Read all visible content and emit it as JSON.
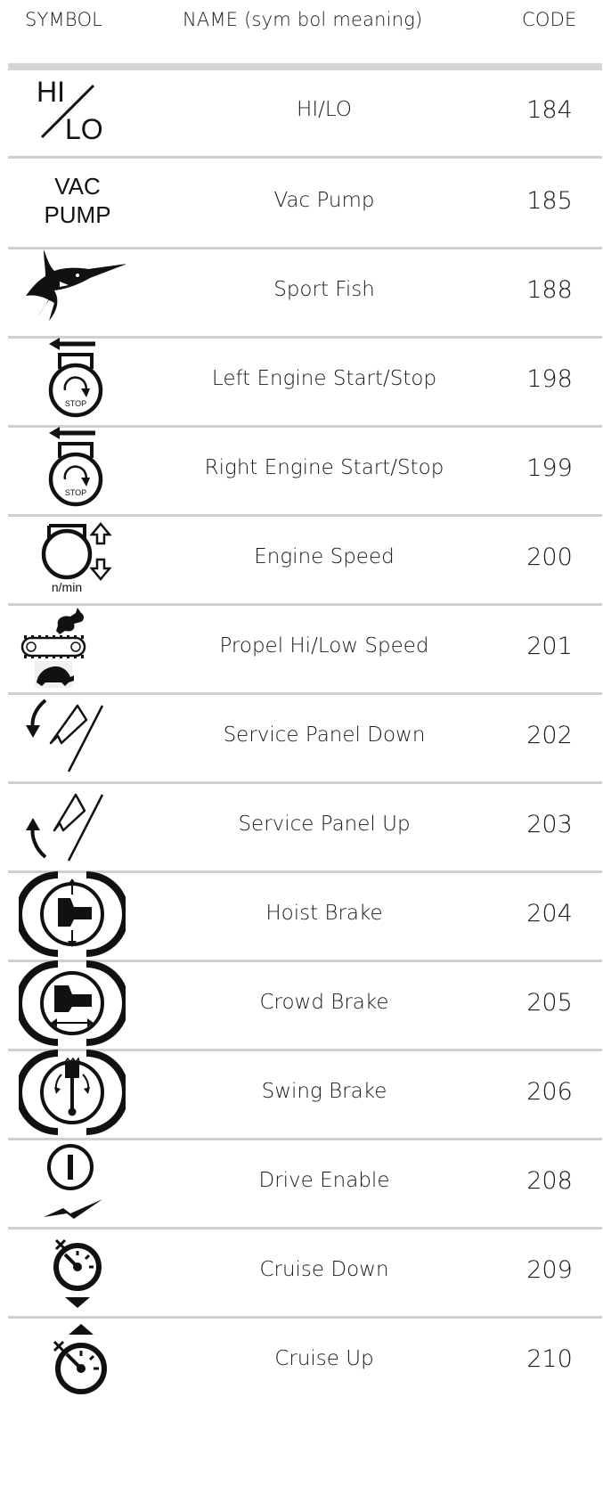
{
  "header": {
    "symbol": "SYMBOL",
    "name": "NAME (sym bol meaning)",
    "code": "CODE"
  },
  "rows": [
    {
      "name": "HI/LO",
      "code": "184",
      "icon": "hi-lo-icon",
      "hi": "HI",
      "lo": "LO"
    },
    {
      "name": "Vac Pump",
      "code": "185",
      "icon": "vac-pump-icon",
      "line1": "VAC",
      "line2": "PUMP"
    },
    {
      "name": "Sport Fish",
      "code": "188",
      "icon": "marlin-icon"
    },
    {
      "name": "Left Engine Start/Stop",
      "code": "198",
      "icon": "left-engine-start-stop-icon",
      "stop": "STOP"
    },
    {
      "name": "Right Engine Start/Stop",
      "code": "199",
      "icon": "right-engine-start-stop-icon",
      "stop": "STOP"
    },
    {
      "name": "Engine Speed",
      "code": "200",
      "icon": "engine-speed-icon",
      "unit": "n/min"
    },
    {
      "name": "Propel Hi/Low Speed",
      "code": "201",
      "icon": "rabbit-turtle-icon"
    },
    {
      "name": "Service Panel Down",
      "code": "202",
      "icon": "service-panel-down-icon"
    },
    {
      "name": "Service Panel Up",
      "code": "203",
      "icon": "service-panel-up-icon"
    },
    {
      "name": "Hoist Brake",
      "code": "204",
      "icon": "hoist-brake-icon"
    },
    {
      "name": "Crowd Brake",
      "code": "205",
      "icon": "crowd-brake-icon"
    },
    {
      "name": "Swing Brake",
      "code": "206",
      "icon": "swing-brake-icon"
    },
    {
      "name": "Drive Enable",
      "code": "208",
      "icon": "drive-enable-icon"
    },
    {
      "name": "Cruise Down",
      "code": "209",
      "icon": "cruise-down-icon"
    },
    {
      "name": "Cruise Up",
      "code": "210",
      "icon": "cruise-up-icon"
    }
  ]
}
